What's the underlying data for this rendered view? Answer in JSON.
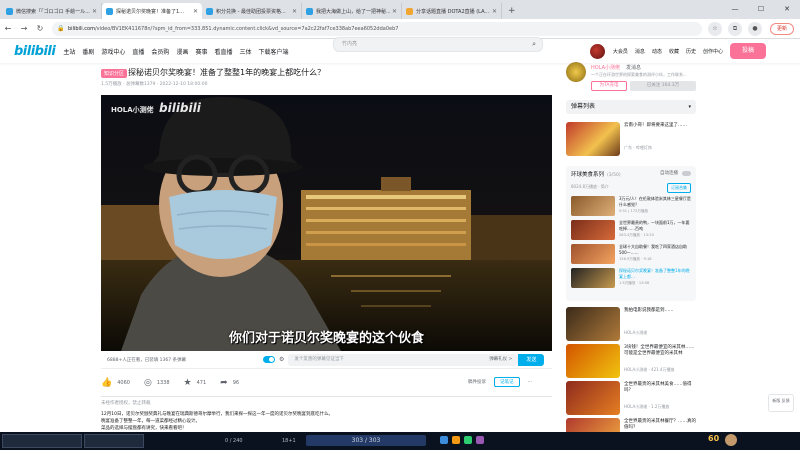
{
  "browser": {
    "tabs": [
      {
        "label": "微信搜索「「ゴロゴロ 手絵一ル...」"
      },
      {
        "label": "探秘诺贝尔奖晚宴！准备了1..."
      },
      {
        "label": "积分兑换 - 最佳助团投票资格..."
      },
      {
        "label": "我把大海做上山，给了一把神秘..."
      },
      {
        "label": "分享话题直播 DOTA2直播 (LA..."
      }
    ],
    "new_tab": "+",
    "url_host": "bilibili.com",
    "url_path": "/video/BV1EK411678n/?spm_id_from=333.851.dynamic.content.click&vd_source=7a2c22faf7ce338ab7eea6052dda0eb7",
    "update_label": "更新",
    "window_controls": [
      "—",
      "☐",
      "✕"
    ]
  },
  "header": {
    "logo": "bilibili",
    "nav": [
      "主站",
      "番剧",
      "游戏中心",
      "直播",
      "会员购",
      "漫画",
      "赛事",
      "看直播",
      "三体",
      "下载客户端"
    ],
    "search_placeholder": "竹内亮",
    "right": [
      "大会员",
      "消息",
      "动态",
      "收藏",
      "历史",
      "创作中心"
    ],
    "upload": "投稿"
  },
  "video": {
    "tag": "知识分区",
    "title": "探秘诺贝尔奖晚宴！准备了整整1年的晚宴上都吃什么？",
    "meta": "1.5万播放 · 总弹幕数1379 · 2022-12-10 18:00:00",
    "watermark_1": "HOLA小测佬",
    "watermark_2": "bilibili",
    "subtitle": "你们对于诺贝尔奖晚宴的这个伙食",
    "watching": "6888+人正在看，已装填 1367 条弹幕",
    "danmaku_placeholder": "发个友善的弹幕见证当下",
    "etiquette": "弹幕礼仪 >",
    "send": "发送",
    "likes": "4060",
    "coins": "1338",
    "favorites": "471",
    "shares": "96",
    "report": "稿件投诉",
    "note": "记笔记",
    "notice": "未经作者授权，禁止转载",
    "desc": [
      "12月10日，诺贝尔奖颁奖典礼与晚宴在瑞典斯德哥尔摩举行，我们来探一探这一年一度的诺贝尔奖晚宴到底吃什么。",
      "晚宴准备了整整一年，每一道菜都经过精心设计。",
      "菜品的选择与摆盘都有讲究，快来看看吧！"
    ]
  },
  "uploader": {
    "name": "HOLA小测佬",
    "msg": "发消息",
    "desc": "一个正在环游世界的探索美食的测评小伙，工作联系...",
    "charge": "为TA充电",
    "follow": "已关注 164.3万"
  },
  "sidebar": {
    "danmaku_list": "弹幕列表",
    "reco_top": {
      "title": "云南小哥！即将要来这里了……",
      "up": "广东 · 哔哩灯饰"
    },
    "series": {
      "title": "环球美食系列",
      "count": "(3/50)",
      "auto": "自动连播",
      "meta": "8024.8万播放 · 简介",
      "subscribe": "订阅合集",
      "items": [
        {
          "title": "3万元/人！在伦敦体验米其林三星餐厅是什么感觉？",
          "sub": "5:51 | 172万播放"
        },
        {
          "title": "全世界最贵的鸭，一块面前1万，一年要吃掉……百吨",
          "sub": "263.4万播放 · 13:20"
        },
        {
          "title": "全球十大自助餐！我吃了四家酒店自助 500—……",
          "sub": "156.9万播放 · 9:18"
        },
        {
          "title": "探秘诺贝尔奖晚宴！准备了整整1年的晚宴上都…",
          "sub": "1.5万播放 · 13:58"
        }
      ]
    },
    "reco": [
      {
        "title": "我拍电影说我都是到……",
        "up": "HOLA小测佬"
      },
      {
        "title": "3块钱！全世界最便宜的米其林……可能是全世界最便宜的米其林",
        "up": "HOLA小测佬 · 421.4万播放"
      },
      {
        "title": "全世界最贵的米其林美食……值得吗？",
        "up": "HOLA小测佬 · 1.2万播放"
      },
      {
        "title": "全世界最贵的米其林餐厅？……真的值吗？",
        "up": "HOLA小测佬"
      }
    ]
  },
  "side_button": "新版\n反馈",
  "taskbar": {
    "time_left": "0 / 240",
    "time_mid": "18+1",
    "center": "303 / 303",
    "right_value": "60"
  }
}
